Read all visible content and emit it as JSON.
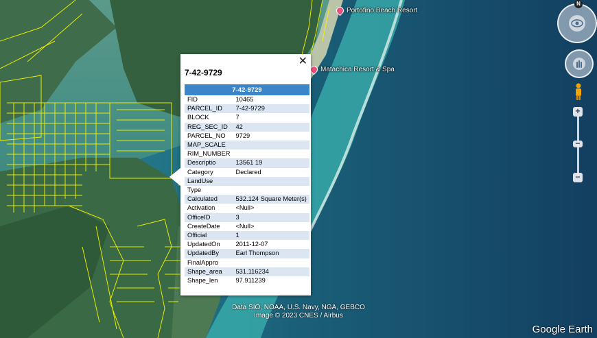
{
  "map": {
    "pois": [
      {
        "label": "Portofino Beach Resort"
      },
      {
        "label": "Matachica Resort & Spa"
      }
    ],
    "attribution_line1": "Data SIO, NOAA, U.S. Navy, NGA, GEBCO",
    "attribution_line2": "Image © 2023 CNES / Airbus",
    "brand": "Google Earth"
  },
  "popup": {
    "title": "7-42-9729",
    "header": "7-42-9729",
    "close_symbol": "✕",
    "rows": [
      {
        "k": "FID",
        "v": "10465"
      },
      {
        "k": "PARCEL_ID",
        "v": "7-42-9729"
      },
      {
        "k": "BLOCK",
        "v": "7"
      },
      {
        "k": "REG_SEC_ID",
        "v": "42"
      },
      {
        "k": "PARCEL_NO",
        "v": "9729"
      },
      {
        "k": "MAP_SCALE",
        "v": ""
      },
      {
        "k": "RIM_NUMBER",
        "v": ""
      },
      {
        "k": "Descriptio",
        "v": "13561 19"
      },
      {
        "k": "Category",
        "v": "Declared"
      },
      {
        "k": "LandUse",
        "v": ""
      },
      {
        "k": "Type",
        "v": ""
      },
      {
        "k": "Calculated",
        "v": "532.124 Square Meter(s)"
      },
      {
        "k": "Activation",
        "v": "<Null>"
      },
      {
        "k": "OfficeID",
        "v": "3"
      },
      {
        "k": "CreateDate",
        "v": "<Null>"
      },
      {
        "k": "Official",
        "v": "1"
      },
      {
        "k": "UpdatedOn",
        "v": "2011-12-07"
      },
      {
        "k": "UpdatedBy",
        "v": "Earl Thompson"
      },
      {
        "k": "FinalAppro",
        "v": ""
      },
      {
        "k": "Shape_area",
        "v": "531.116234"
      },
      {
        "k": "Shape_len",
        "v": "97.911239"
      }
    ]
  },
  "nav": {
    "north": "N",
    "zoom_in": "+",
    "zoom_out": "−"
  },
  "colors": {
    "parcel_outline": "#f2f200",
    "header_bg": "#3a86c8",
    "row_alt": "#dce6f2",
    "pin": "#e7517b"
  }
}
